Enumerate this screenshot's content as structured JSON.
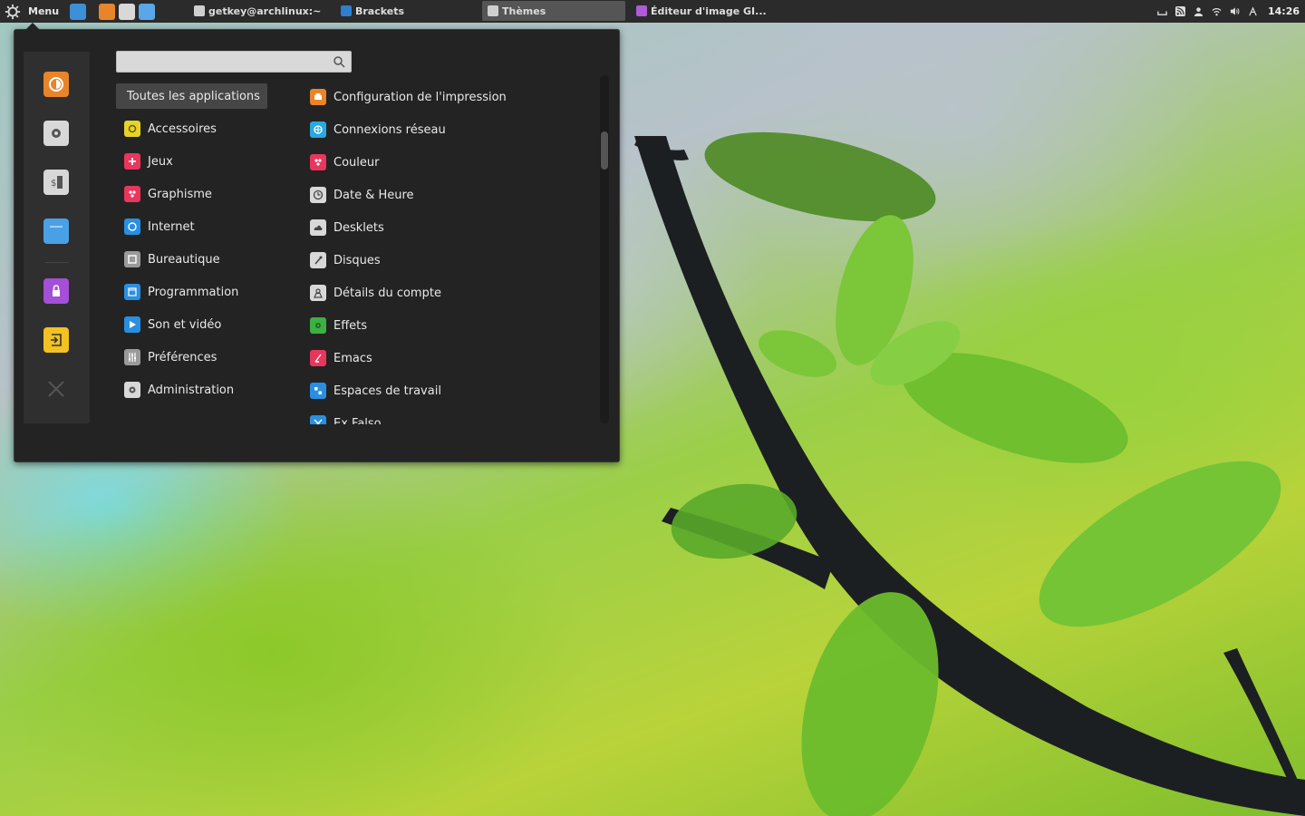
{
  "panel": {
    "menu_label": "Menu",
    "launchers": [
      {
        "name": "files-launcher",
        "color": "#3d8fd8"
      },
      {
        "name": "firefox-launcher",
        "color": "#e8842a"
      },
      {
        "name": "terminal-launcher",
        "color": "#d8d8d8"
      },
      {
        "name": "files2-launcher",
        "color": "#5aa6e8"
      }
    ],
    "tasks": [
      {
        "label": "getkey@archlinux:~",
        "color": "#cfcfcf",
        "active": false
      },
      {
        "label": "Brackets",
        "color": "#2e7fd0",
        "active": false
      },
      {
        "label": "Thèmes",
        "color": "#cfcfcf",
        "active": true
      },
      {
        "label": "Éditeur d'image GI...",
        "color": "#b05ad8",
        "active": false
      }
    ],
    "tray_icons": [
      "keyboard-icon",
      "rss-icon",
      "user-icon",
      "wifi-icon",
      "volume-icon",
      "accessibility-icon"
    ],
    "clock": "14:26"
  },
  "menu": {
    "search": {
      "value": "",
      "placeholder": ""
    },
    "favorites": [
      {
        "name": "firefox-icon",
        "color": "#e8842a"
      },
      {
        "name": "settings-icon",
        "color": "#d8d8d8"
      },
      {
        "name": "terminal-icon",
        "color": "#d8d8d8"
      },
      {
        "name": "files-icon",
        "color": "#4aa0e6"
      },
      {
        "name": "lock-icon",
        "color": "#a34fd6"
      },
      {
        "name": "logout-icon",
        "color": "#f2c122"
      },
      {
        "name": "quit-icon",
        "color": "#555555"
      }
    ],
    "categories": [
      {
        "label": "Toutes les applications",
        "icon": "",
        "color": "",
        "selected": true
      },
      {
        "label": "Accessoires",
        "icon": "accessories-icon",
        "color": "#e5d32a"
      },
      {
        "label": "Jeux",
        "icon": "games-icon",
        "color": "#e8365d"
      },
      {
        "label": "Graphisme",
        "icon": "graphics-icon",
        "color": "#e8365d"
      },
      {
        "label": "Internet",
        "icon": "internet-icon",
        "color": "#2a8fe0"
      },
      {
        "label": "Bureautique",
        "icon": "office-icon",
        "color": "#9a9a9a"
      },
      {
        "label": "Programmation",
        "icon": "programming-icon",
        "color": "#2a8fe0"
      },
      {
        "label": "Son et vidéo",
        "icon": "multimedia-icon",
        "color": "#2a8fe0"
      },
      {
        "label": "Préférences",
        "icon": "preferences-icon",
        "color": "#9a9a9a"
      },
      {
        "label": "Administration",
        "icon": "administration-icon",
        "color": "#d8d8d8"
      }
    ],
    "apps": [
      {
        "label": "Configuration de l'impression",
        "icon": "printer-icon",
        "color": "#e8842a"
      },
      {
        "label": "Connexions réseau",
        "icon": "network-icon",
        "color": "#2aa8e0"
      },
      {
        "label": "Couleur",
        "icon": "color-icon",
        "color": "#e8365d"
      },
      {
        "label": "Date & Heure",
        "icon": "clock-icon",
        "color": "#d8d8d8"
      },
      {
        "label": "Desklets",
        "icon": "desklets-icon",
        "color": "#d8d8d8"
      },
      {
        "label": "Disques",
        "icon": "disks-icon",
        "color": "#d8d8d8"
      },
      {
        "label": "Détails du compte",
        "icon": "account-icon",
        "color": "#d8d8d8"
      },
      {
        "label": "Effets",
        "icon": "effects-icon",
        "color": "#3cb043"
      },
      {
        "label": "Emacs",
        "icon": "emacs-icon",
        "color": "#e8365d"
      },
      {
        "label": "Espaces de travail",
        "icon": "workspaces-icon",
        "color": "#2a8fe0"
      },
      {
        "label": "Ex Falso",
        "icon": "exfalso-icon",
        "color": "#2a8fe0"
      }
    ]
  }
}
